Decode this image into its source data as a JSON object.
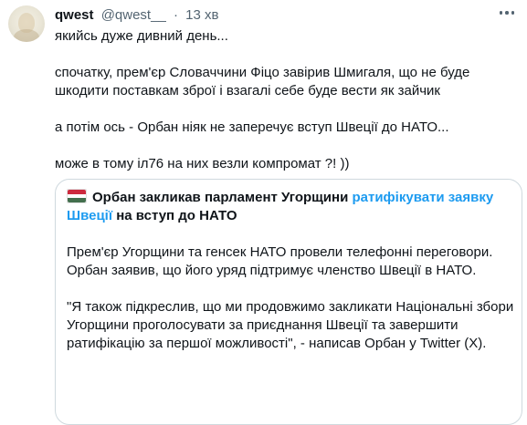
{
  "user": {
    "name": "qwest",
    "handle": "@qwest__",
    "separator": "·",
    "time": "13 хв",
    "avatar_icon": "profile-avatar"
  },
  "tweet": {
    "paragraphs": [
      "якийсь дуже дивний день...",
      "спочатку, прем'єр Словаччини Фіцо завірив Шмигаля, що не буде шкодити поставкам зброї і взагалі себе буде вести як зайчик",
      "а потім ось - Орбан ніяк не заперечує вступ Швеції до НАТО...",
      "може в тому іл76 на них везли компромат ?! ))"
    ]
  },
  "quote": {
    "flag_icon": "hungary-flag-icon",
    "title_part1": "Орбан закликав парламент Угорщини ",
    "title_link": "ратифікувати заявку Швеції",
    "title_part2": " на вступ до НАТО",
    "paragraphs": [
      "Прем'єр Угорщини та генсек НАТО провели телефонні переговори. Орбан заявив, що його уряд підтримує членство Швеції в НАТО.",
      "\"Я також підкреслив, що ми продовжимо закликати Національні збори Угорщини проголосувати за приєднання Швеції та завершити ратифікацію за першої можливості\", - написав Орбан у Twitter (X)."
    ]
  },
  "colors": {
    "text": "#0f1419",
    "secondary": "#536471",
    "link": "#1d9bf0",
    "border": "#cfd9de"
  }
}
